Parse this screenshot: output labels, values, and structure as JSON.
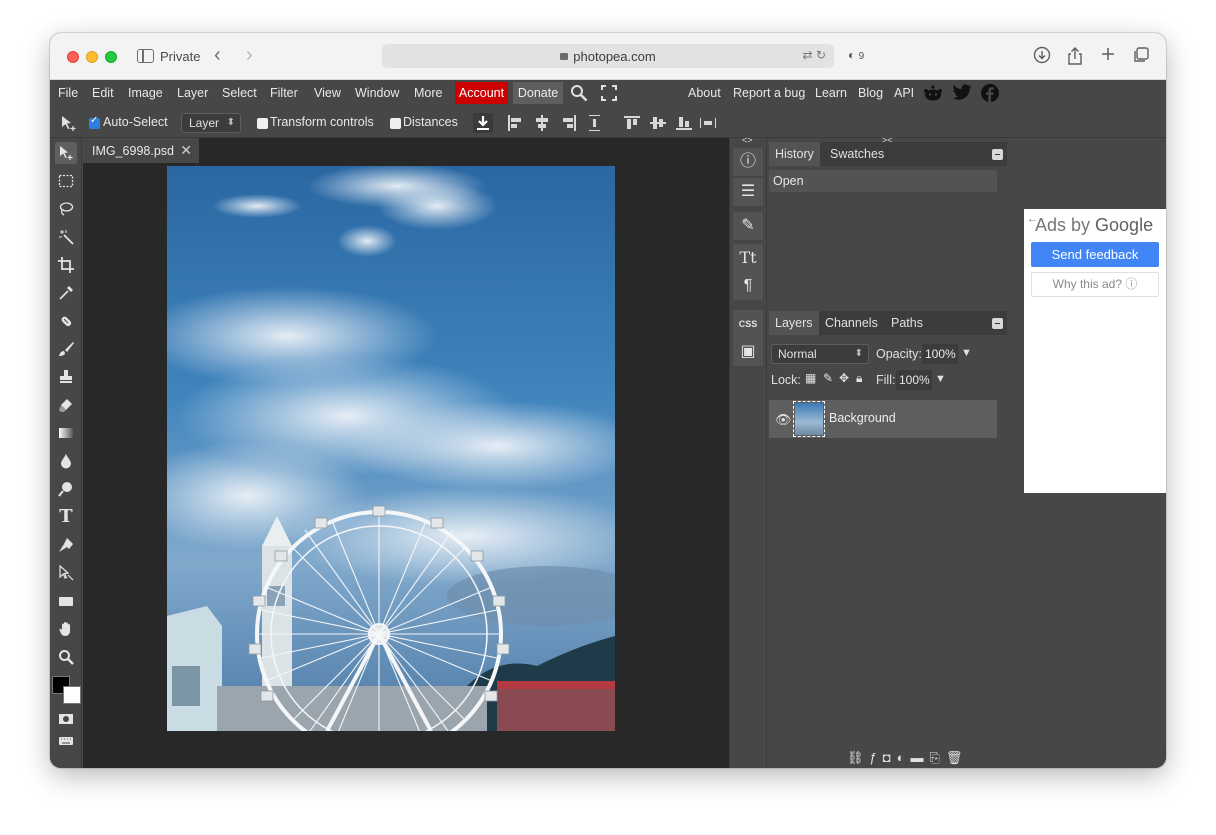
{
  "browser": {
    "private_label": "Private",
    "url": "photopea.com",
    "shield_count": "9"
  },
  "menu": {
    "items": [
      "File",
      "Edit",
      "Image",
      "Layer",
      "Select",
      "Filter",
      "View",
      "Window",
      "More"
    ],
    "account": "Account",
    "donate": "Donate",
    "right_links": [
      "About",
      "Report a bug",
      "Learn",
      "Blog",
      "API"
    ]
  },
  "options": {
    "auto_select": "Auto-Select",
    "auto_select_checked": true,
    "target": "Layer",
    "transform_controls": "Transform controls",
    "distances": "Distances"
  },
  "document": {
    "tab_name": "IMG_6998.psd"
  },
  "panels": {
    "history_tabs": [
      "History",
      "Swatches"
    ],
    "history_items": [
      "Open"
    ],
    "layers_tabs": [
      "Layers",
      "Channels",
      "Paths"
    ],
    "blend_mode": "Normal",
    "opacity_label": "Opacity:",
    "opacity": "100%",
    "lock_label": "Lock:",
    "fill_label": "Fill:",
    "fill": "100%",
    "layer_name": "Background",
    "css_label": "CSS"
  },
  "ad": {
    "title_prefix": "Ads by ",
    "title_brand": "Google",
    "send_feedback": "Send feedback",
    "why": "Why this ad? ⓘ"
  }
}
